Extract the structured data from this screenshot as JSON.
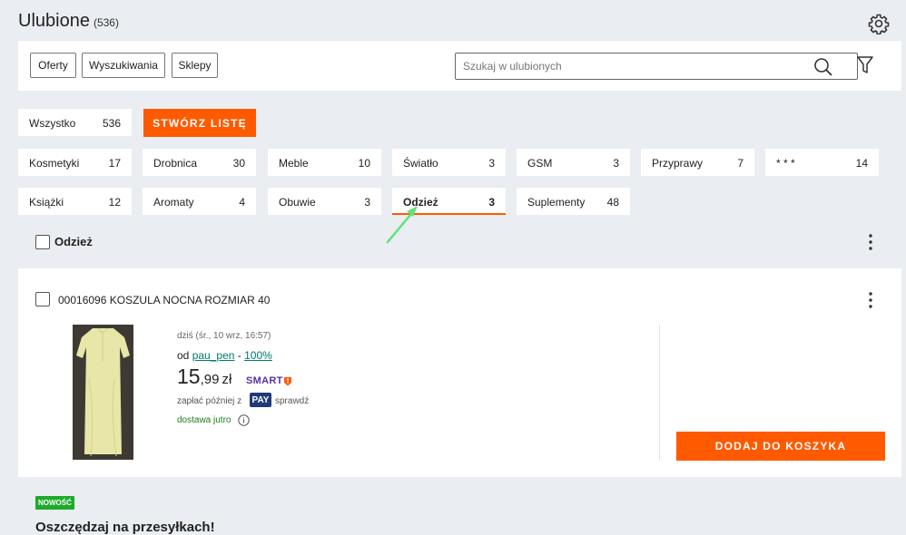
{
  "header": {
    "title": "Ulubione",
    "count": "(536)"
  },
  "toolbar": {
    "tabs": [
      "Oferty",
      "Wyszukiwania",
      "Sklepy"
    ],
    "search_placeholder": "Szukaj w ulubionych"
  },
  "lists": {
    "all_label": "Wszystko",
    "all_count": "536",
    "create_label": "STWÓRZ LISTĘ",
    "categories": [
      {
        "name": "Kosmetyki",
        "count": "17"
      },
      {
        "name": "Drobnica",
        "count": "30"
      },
      {
        "name": "Meble",
        "count": "10"
      },
      {
        "name": "Światło",
        "count": "3"
      },
      {
        "name": "GSM",
        "count": "3"
      },
      {
        "name": "Przyprawy",
        "count": "7"
      },
      {
        "name": "* * *",
        "count": "14"
      },
      {
        "name": "Książki",
        "count": "12"
      },
      {
        "name": "Aromaty",
        "count": "4"
      },
      {
        "name": "Obuwie",
        "count": "3"
      },
      {
        "name": "Odzież",
        "count": "3"
      },
      {
        "name": "Suplementy",
        "count": "48"
      }
    ],
    "active": "Odzież"
  },
  "section": {
    "title": "Odzież"
  },
  "product": {
    "title": "00016096 KOSZULA NOCNA ROZMIAR 40",
    "date": "dziś (śr., 10 wrz, 16:57)",
    "seller_prefix": "od",
    "seller": "pau_pen",
    "separator": "-",
    "rating": "100%",
    "price_int": "15",
    "price_dec": ",99",
    "currency": "zł",
    "smart": "SMART",
    "pay_later": "zapłać później z",
    "pay_badge": "PAY",
    "check": "sprawdź",
    "delivery": "dostawa jutro",
    "add_to_cart": "DODAJ DO KOSZYKA"
  },
  "promo": {
    "badge": "NOWOŚĆ",
    "text": "Oszczędzaj na przesyłkach!"
  },
  "colors": {
    "accent": "#ff5a00",
    "background": "#eaedf1",
    "seller_link": "#00796b",
    "delivery": "#1b7d1b",
    "new_badge": "#1eaa2b",
    "pay_badge": "#1f3a7a"
  }
}
